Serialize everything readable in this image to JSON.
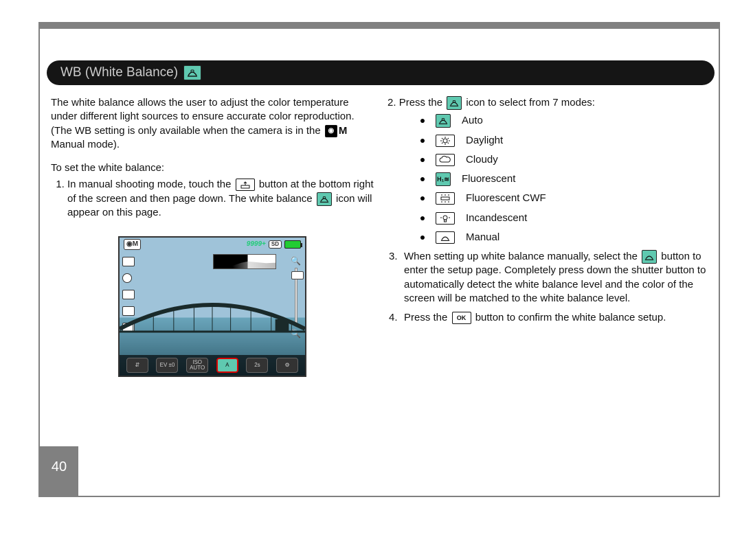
{
  "page_number": "40",
  "heading": "WB (White Balance)",
  "intro": "The white balance allows the user to adjust the color temperature under different light sources to ensure accurate color reproduction.(The WB setting is only available when the camera is in the ",
  "intro_mode_icon_label": "M",
  "intro_tail": " Manual mode).",
  "subheading": "To set the white balance:",
  "step1_a": "In manual shooting mode, touch the ",
  "step1_b": " button at the bottom right of the screen and then page down. The white balance ",
  "step1_c": " icon will appear on this page.",
  "step2_a": "Press the ",
  "step2_b": " icon to select from 7 modes:",
  "modes": [
    "Auto",
    "Daylight",
    "Cloudy",
    "Fluorescent",
    "Fluorescent CWF",
    "Incandescent",
    "Manual"
  ],
  "step3_a": "When setting up white balance manually, select the ",
  "step3_b": " button to enter the setup page. Completely press down the shutter button to automatically detect the white balance level and the color of the screen will be matched to the white balance level.",
  "step4_a": "Press the ",
  "step4_ok": "OK",
  "step4_b": " button to confirm the white balance setup.",
  "screenshot": {
    "counter": "9999+",
    "card": "SD",
    "bottom_buttons": [
      "⇵",
      "EV ±0",
      "ISO AUTO",
      "A",
      "2s",
      "⚙"
    ],
    "highlight_index": 3
  }
}
